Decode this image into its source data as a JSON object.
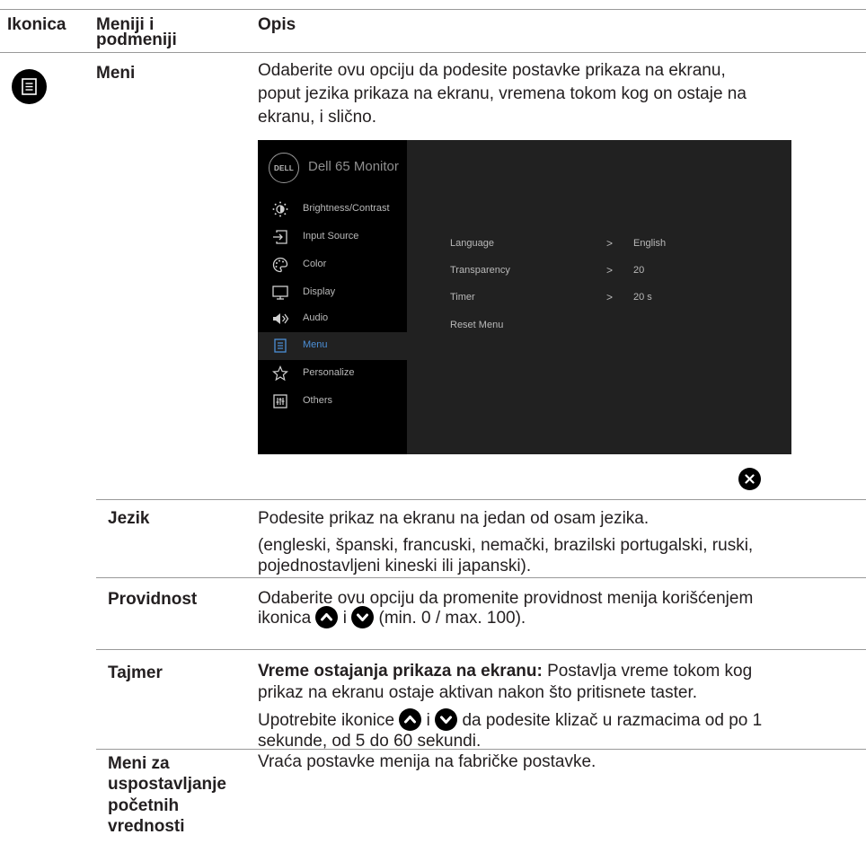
{
  "header": {
    "col1": "Ikonica",
    "col2_line1": "Meniji i",
    "col2_line2": "podmeniji",
    "col3": "Opis"
  },
  "main_row": {
    "icon": "menu-list-icon",
    "label": "Meni",
    "desc_line1": "Odaberite ovu opciju da podesite postavke prikaza na ekranu,",
    "desc_line2": "poput jezika prikaza na ekranu, vremena tokom kog on ostaje na",
    "desc_line3": "ekranu, i slično."
  },
  "osd": {
    "logo": "DELL",
    "title": "Dell 65 Monitor",
    "menu": [
      {
        "label": "Brightness/Contrast",
        "icon": "brightness-icon"
      },
      {
        "label": "Input Source",
        "icon": "input-source-icon"
      },
      {
        "label": "Color",
        "icon": "color-palette-icon"
      },
      {
        "label": "Display",
        "icon": "display-icon"
      },
      {
        "label": "Audio",
        "icon": "speaker-icon"
      },
      {
        "label": "Menu",
        "icon": "menu-list-icon"
      },
      {
        "label": "Personalize",
        "icon": "star-icon"
      },
      {
        "label": "Others",
        "icon": "others-icon"
      }
    ],
    "active_item": "Menu",
    "submenu": [
      {
        "name": "Language",
        "chevron": ">",
        "value": "English"
      },
      {
        "name": "Transparency",
        "chevron": ">",
        "value": "20"
      },
      {
        "name": "Timer",
        "chevron": ">",
        "value": "20 s"
      },
      {
        "name": "Reset Menu",
        "chevron": "",
        "value": ""
      }
    ],
    "colors": {
      "panel": "#000000",
      "content": "#212121",
      "active_text": "#4c8fd6",
      "text": "#b9b9b9"
    }
  },
  "rows": {
    "jezik": {
      "label": "Jezik",
      "line1": "Podesite prikaz na ekranu na jedan od osam jezika.",
      "line2": "(engleski, španski, francuski, nemački, brazilski portugalski, ruski,",
      "line3": "pojednostavljeni kineski ili japanski)."
    },
    "providnost": {
      "label": "Providnost",
      "line1": "Odaberite ovu opciju da promenite providnost menija korišćenjem",
      "line2_a": "ikonica",
      "line2_b": "i",
      "line2_c": "(min. 0 / max. 100)."
    },
    "tajmer": {
      "label": "Tajmer",
      "bold": "Vreme ostajanja prikaza na ekranu:",
      "line1_rest": " Postavlja vreme tokom kog",
      "line2": "prikaz na ekranu ostaje aktivan nakon što pritisnete taster.",
      "line3_a": "Upotrebite ikonice",
      "line3_b": "i",
      "line3_c": "da podesite klizač u razmacima od po 1",
      "line4": "sekunde, od 5 do 60 sekundi."
    },
    "reset": {
      "label1": "Meni za",
      "label2": "uspostavljanje",
      "label3": "početnih",
      "label4": "vrednosti",
      "line1": "Vraća postavke menija na fabričke postavke."
    }
  },
  "icons": {
    "up": "up-arrow-icon",
    "down": "down-arrow-icon",
    "close": "close-icon"
  }
}
